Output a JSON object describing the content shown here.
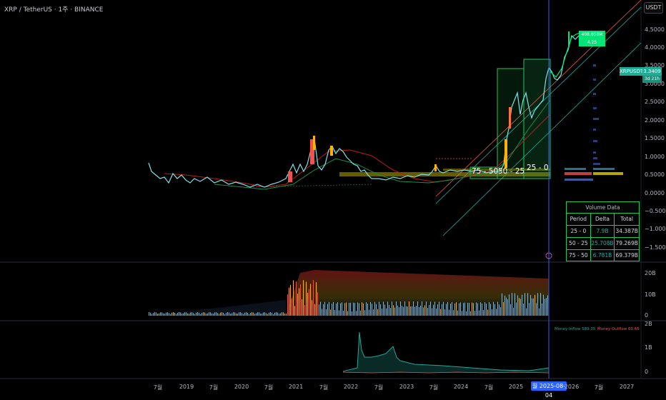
{
  "header": {
    "title": "XRP / TetherUS · 1주 · BINANCE",
    "currency_button": "USDT"
  },
  "price_axis": {
    "ticks": [
      "4.5000",
      "4.0000",
      "3.5000",
      "3.0000",
      "2.5000",
      "2.0000",
      "1.5000",
      "1.0000",
      "0.5000",
      "0.0000",
      "−0.5000",
      "−1.0000",
      "−1.5000"
    ]
  },
  "price_label": {
    "symbol": "XRPUSDT",
    "price": "3.3409",
    "countdown": "3d 21h"
  },
  "annotation": {
    "volume": "408.858M",
    "value": "4.25"
  },
  "time_axis": {
    "ticks": [
      "7월",
      "2019",
      "7월",
      "2020",
      "7월",
      "2021",
      "7월",
      "2022",
      "7월",
      "2023",
      "7월",
      "2024",
      "7월",
      "2025",
      "월 2025-08-04",
      "2026",
      "7월",
      "2027"
    ]
  },
  "box_labels": {
    "b75_50": "75 - 50",
    "b50_25": "50 - 25",
    "b25_0": "25 - 0"
  },
  "volume_table": {
    "title": "Volume Data",
    "headers": [
      "Period",
      "Delta",
      "Total"
    ],
    "rows": [
      {
        "period": "25 - 0",
        "delta": "7.9B",
        "total": "34.387B"
      },
      {
        "period": "50 - 25",
        "delta": "25.708B",
        "total": "79.269B"
      },
      {
        "period": "75 - 50",
        "delta": "6.781B",
        "total": "69.379B"
      }
    ],
    "delta_color": "#26a69a"
  },
  "volume_pane": {
    "ticks": [
      "20B",
      "10B",
      "0"
    ]
  },
  "flow_pane": {
    "ticks": [
      "2B",
      "1B",
      "0"
    ],
    "inflow_label": "Money Inflow 589.35",
    "outflow_label": "Money Outflow 60.65"
  },
  "colors": {
    "accent": "#2962ff",
    "up": "#26a69a",
    "down": "#ef5350",
    "box": "#22c55e"
  }
}
